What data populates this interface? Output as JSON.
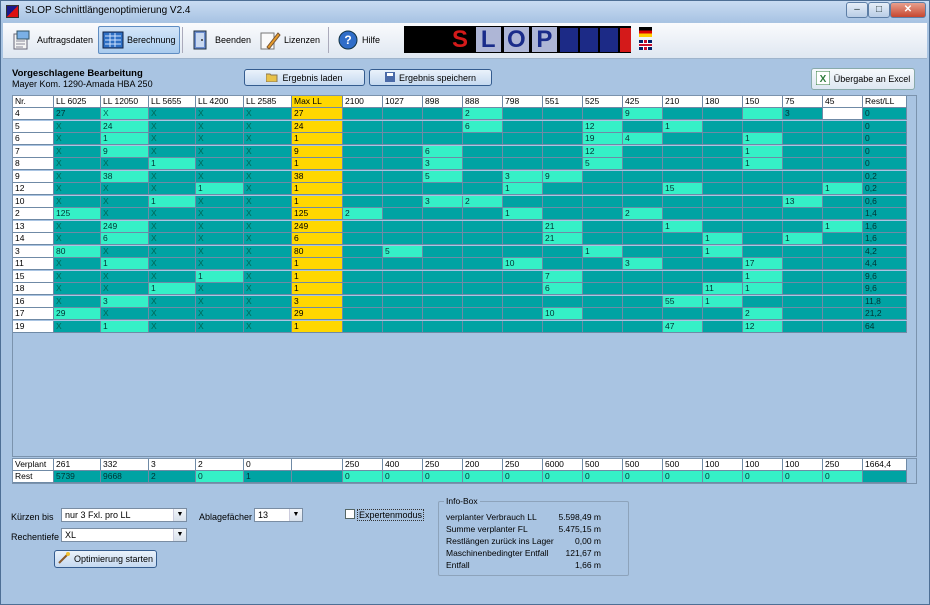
{
  "window": {
    "title": "SLOP Schnittlängenoptimierung V2.4",
    "minimize": "–",
    "maximize": "□",
    "close": "✕"
  },
  "toolbar": {
    "auftragsdaten": "Auftragsdaten",
    "berechnung": "Berechnung",
    "beenden": "Beenden",
    "lizenzen": "Lizenzen",
    "hilfe": "Hilfe",
    "logo_letters": [
      "S",
      "L",
      "O",
      "P"
    ]
  },
  "header": {
    "title": "Vorgeschlagene Bearbeitung",
    "subtitle": "Mayer Kom. 1290-Amada HBA  250"
  },
  "buttons": {
    "load": "Ergebnis laden",
    "save": "Ergebnis speichern",
    "excel": "Übergabe an Excel"
  },
  "table": {
    "columns": [
      "Nr.",
      "LL 6025",
      "LL 12050",
      "LL 5655",
      "LL 4200",
      "LL 2585",
      "Max LL",
      "2100",
      "1027",
      "898",
      "888",
      "798",
      "551",
      "525",
      "425",
      "210",
      "180",
      "150",
      "75",
      "45",
      "Rest/LL"
    ],
    "rows": [
      [
        "4",
        "27",
        "X",
        "X",
        "X",
        "X",
        "27",
        "",
        "",
        "",
        "2",
        "",
        "",
        "",
        "9",
        "",
        "",
        "",
        "3",
        "",
        "0"
      ],
      [
        "5",
        "X",
        "24",
        "X",
        "X",
        "X",
        "24",
        "",
        "",
        "",
        "6",
        "",
        "",
        "12",
        "",
        "1",
        "",
        "",
        "",
        "",
        "0"
      ],
      [
        "6",
        "X",
        "1",
        "X",
        "X",
        "X",
        "1",
        "",
        "",
        "",
        "",
        "",
        "",
        "19",
        "4",
        "",
        "",
        "1",
        "",
        "",
        "0"
      ],
      [
        "7",
        "X",
        "9",
        "X",
        "X",
        "X",
        "9",
        "",
        "",
        "6",
        "",
        "",
        "",
        "12",
        "",
        "",
        "",
        "1",
        "",
        "",
        "0"
      ],
      [
        "8",
        "X",
        "X",
        "1",
        "X",
        "X",
        "1",
        "",
        "",
        "3",
        "",
        "",
        "",
        "5",
        "",
        "",
        "",
        "1",
        "",
        "",
        "0"
      ],
      [
        "9",
        "X",
        "38",
        "X",
        "X",
        "X",
        "38",
        "",
        "",
        "5",
        "",
        "3",
        "9",
        "",
        "",
        "",
        "",
        "",
        "",
        "",
        "0,2"
      ],
      [
        "12",
        "X",
        "X",
        "X",
        "1",
        "X",
        "1",
        "",
        "",
        "",
        "",
        "1",
        "",
        "",
        "",
        "15",
        "",
        "",
        "",
        "1",
        "0,2"
      ],
      [
        "10",
        "X",
        "X",
        "1",
        "X",
        "X",
        "1",
        "",
        "",
        "3",
        "2",
        "",
        "",
        "",
        "",
        "",
        "",
        "",
        "13",
        "",
        "0,6"
      ],
      [
        "2",
        "125",
        "X",
        "X",
        "X",
        "X",
        "125",
        "2",
        "",
        "",
        "",
        "1",
        "",
        "",
        "2",
        "",
        "",
        "",
        "",
        "",
        "1,4"
      ],
      [
        "13",
        "X",
        "249",
        "X",
        "X",
        "X",
        "249",
        "",
        "",
        "",
        "",
        "",
        "21",
        "",
        "",
        "1",
        "",
        "",
        "",
        "1",
        "1,6"
      ],
      [
        "14",
        "X",
        "6",
        "X",
        "X",
        "X",
        "6",
        "",
        "",
        "",
        "",
        "",
        "21",
        "",
        "",
        "",
        "1",
        "",
        "1",
        "",
        "1,6"
      ],
      [
        "3",
        "80",
        "X",
        "X",
        "X",
        "X",
        "80",
        "",
        "5",
        "",
        "",
        "",
        "",
        "1",
        "",
        "",
        "1",
        "",
        "",
        "",
        "4,2"
      ],
      [
        "11",
        "X",
        "1",
        "X",
        "X",
        "X",
        "1",
        "",
        "",
        "",
        "",
        "10",
        "",
        "",
        "3",
        "",
        "",
        "17",
        "",
        "",
        "4,4"
      ],
      [
        "15",
        "X",
        "X",
        "X",
        "1",
        "X",
        "1",
        "",
        "",
        "",
        "",
        "",
        "7",
        "",
        "",
        "",
        "",
        "1",
        "",
        "",
        "9,6"
      ],
      [
        "18",
        "X",
        "X",
        "1",
        "X",
        "X",
        "1",
        "",
        "",
        "",
        "",
        "",
        "6",
        "",
        "",
        "",
        "11",
        "1",
        "",
        "",
        "9,6"
      ],
      [
        "16",
        "X",
        "3",
        "X",
        "X",
        "X",
        "3",
        "",
        "",
        "",
        "",
        "",
        "",
        "",
        "",
        "55",
        "1",
        "",
        "",
        "",
        "11,8"
      ],
      [
        "17",
        "29",
        "X",
        "X",
        "X",
        "X",
        "29",
        "",
        "",
        "",
        "",
        "",
        "10",
        "",
        "",
        "",
        "",
        "2",
        "",
        "",
        "21,2"
      ],
      [
        "19",
        "X",
        "1",
        "X",
        "X",
        "X",
        "1",
        "",
        "",
        "",
        "",
        "",
        "",
        "",
        "",
        "47",
        "",
        "12",
        "",
        "",
        "64"
      ]
    ],
    "shading": [
      "DLDDDYDDDLDDDLDDLDW",
      "DLDDDYDDDLDDLDLDDDD",
      "DLDDDYDDDDDDLLDDLDD",
      "DLDDDYDDLDDDLDDDLDD",
      "DDLDDYDDLDDDLDDDLDD",
      "DLDDDYDDLDLLDDDDDDD",
      "DDDLDYDDDDLDDDLDDDL",
      "DDLDDYDDLLDDDDDDDLD",
      "LDDDDYLDDDLDDLDDDDD",
      "DLDDDYDDDDDLDDLDDDL",
      "DLDDDYDDDDDLDDDLDLD",
      "LDDDDYDLDDDDLDDLDDD",
      "DLDDDYDDDDLDDLDDLDD",
      "DDDLDYDDDDDLDDDDLDD",
      "DDLDDYDDDDDLDDDLLDD",
      "DLDDDYDDDDDDDDLLDDD",
      "LDDDDYDDDDDLDDDDLDD",
      "DLDDDYDDDDDDDDLDLDD"
    ],
    "verplant": [
      "Verplant",
      "261",
      "332",
      "3",
      "2",
      "0",
      "",
      "250",
      "400",
      "250",
      "200",
      "250",
      "6000",
      "500",
      "500",
      "500",
      "100",
      "100",
      "100",
      "250",
      "1664,4"
    ],
    "rest": [
      "Rest",
      "5739",
      "9668",
      "2",
      "0",
      "1",
      "",
      "0",
      "0",
      "0",
      "0",
      "0",
      "0",
      "0",
      "0",
      "0",
      "0",
      "0",
      "0",
      "0",
      ""
    ]
  },
  "controls": {
    "kuerzen_label": "Kürzen bis",
    "kuerzen_value": "nur 3 Fxl. pro LL",
    "rechentiefe_label": "Rechentiefe",
    "rechentiefe_value": "XL",
    "ablage_label": "Ablagefächer",
    "ablage_value": "13",
    "experten_label": "Expertenmodus",
    "start_button": "Optimierung starten"
  },
  "infobox": {
    "title": "Info-Box",
    "items": [
      {
        "label": "verplanter Verbrauch LL",
        "value": "5.598,49 m"
      },
      {
        "label": "Summe verplanter FL",
        "value": "5.475,15 m"
      },
      {
        "label": "Restlängen zurück ins Lager",
        "value": "0,00 m"
      },
      {
        "label": "Maschinenbedingter Entfall",
        "value": "121,67 m"
      },
      {
        "label": "Entfall",
        "value": "1,66 m"
      }
    ]
  },
  "colors": {
    "dark_cell": "#00a3a3",
    "light_cell": "#35f0c7",
    "max_ll": "#ffd700",
    "background": "#a9c4e2"
  }
}
